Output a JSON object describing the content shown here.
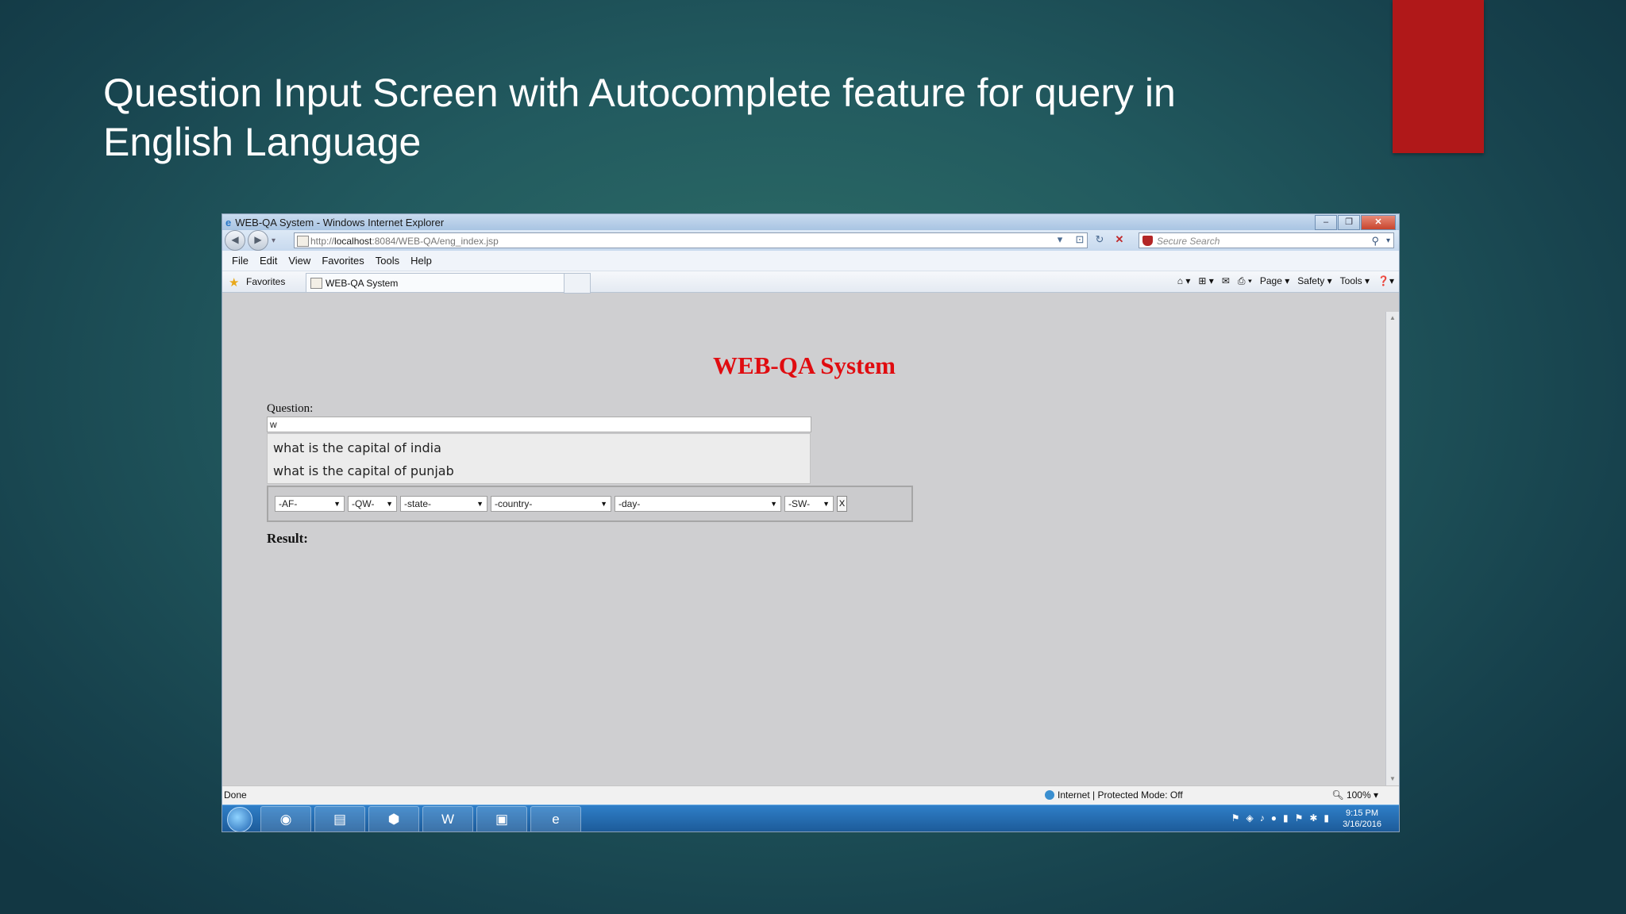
{
  "slide": {
    "title_line1": "Question Input Screen with Autocomplete feature for query in",
    "title_line2": "English Language"
  },
  "colors": {
    "accent": "#b01819",
    "page_heading": "#e00c10"
  },
  "browser": {
    "window_title": "WEB-QA System - Windows Internet Explorer",
    "address_prefix": "http://",
    "address_host": "localhost",
    "address_rest": ":8084/WEB-QA/eng_index.jsp",
    "search_placeholder": "Secure Search",
    "menu": [
      "File",
      "Edit",
      "View",
      "Favorites",
      "Tools",
      "Help"
    ],
    "favorites_label": "Favorites",
    "tab_label": "WEB-QA System",
    "command_bar": [
      "Page ▾",
      "Safety ▾",
      "Tools ▾"
    ],
    "status_left": "Done",
    "status_zone": "Internet | Protected Mode: Off",
    "zoom": "100%"
  },
  "page": {
    "heading": "WEB-QA System",
    "question_label": "Question:",
    "question_value": "w",
    "suggestions": [
      "what is the capital of india",
      "what is the capital of punjab"
    ],
    "selects": [
      "-AF-",
      "-QW-",
      "-state-",
      "-country-",
      "-day-",
      "-SW-"
    ],
    "clear_label": "X",
    "result_label": "Result:"
  },
  "taskbar": {
    "time": "9:15 PM",
    "date": "3/16/2016",
    "apps": [
      "chrome-icon",
      "folder-icon",
      "box-icon",
      "word-icon",
      "network-icon",
      "ie-icon"
    ]
  }
}
